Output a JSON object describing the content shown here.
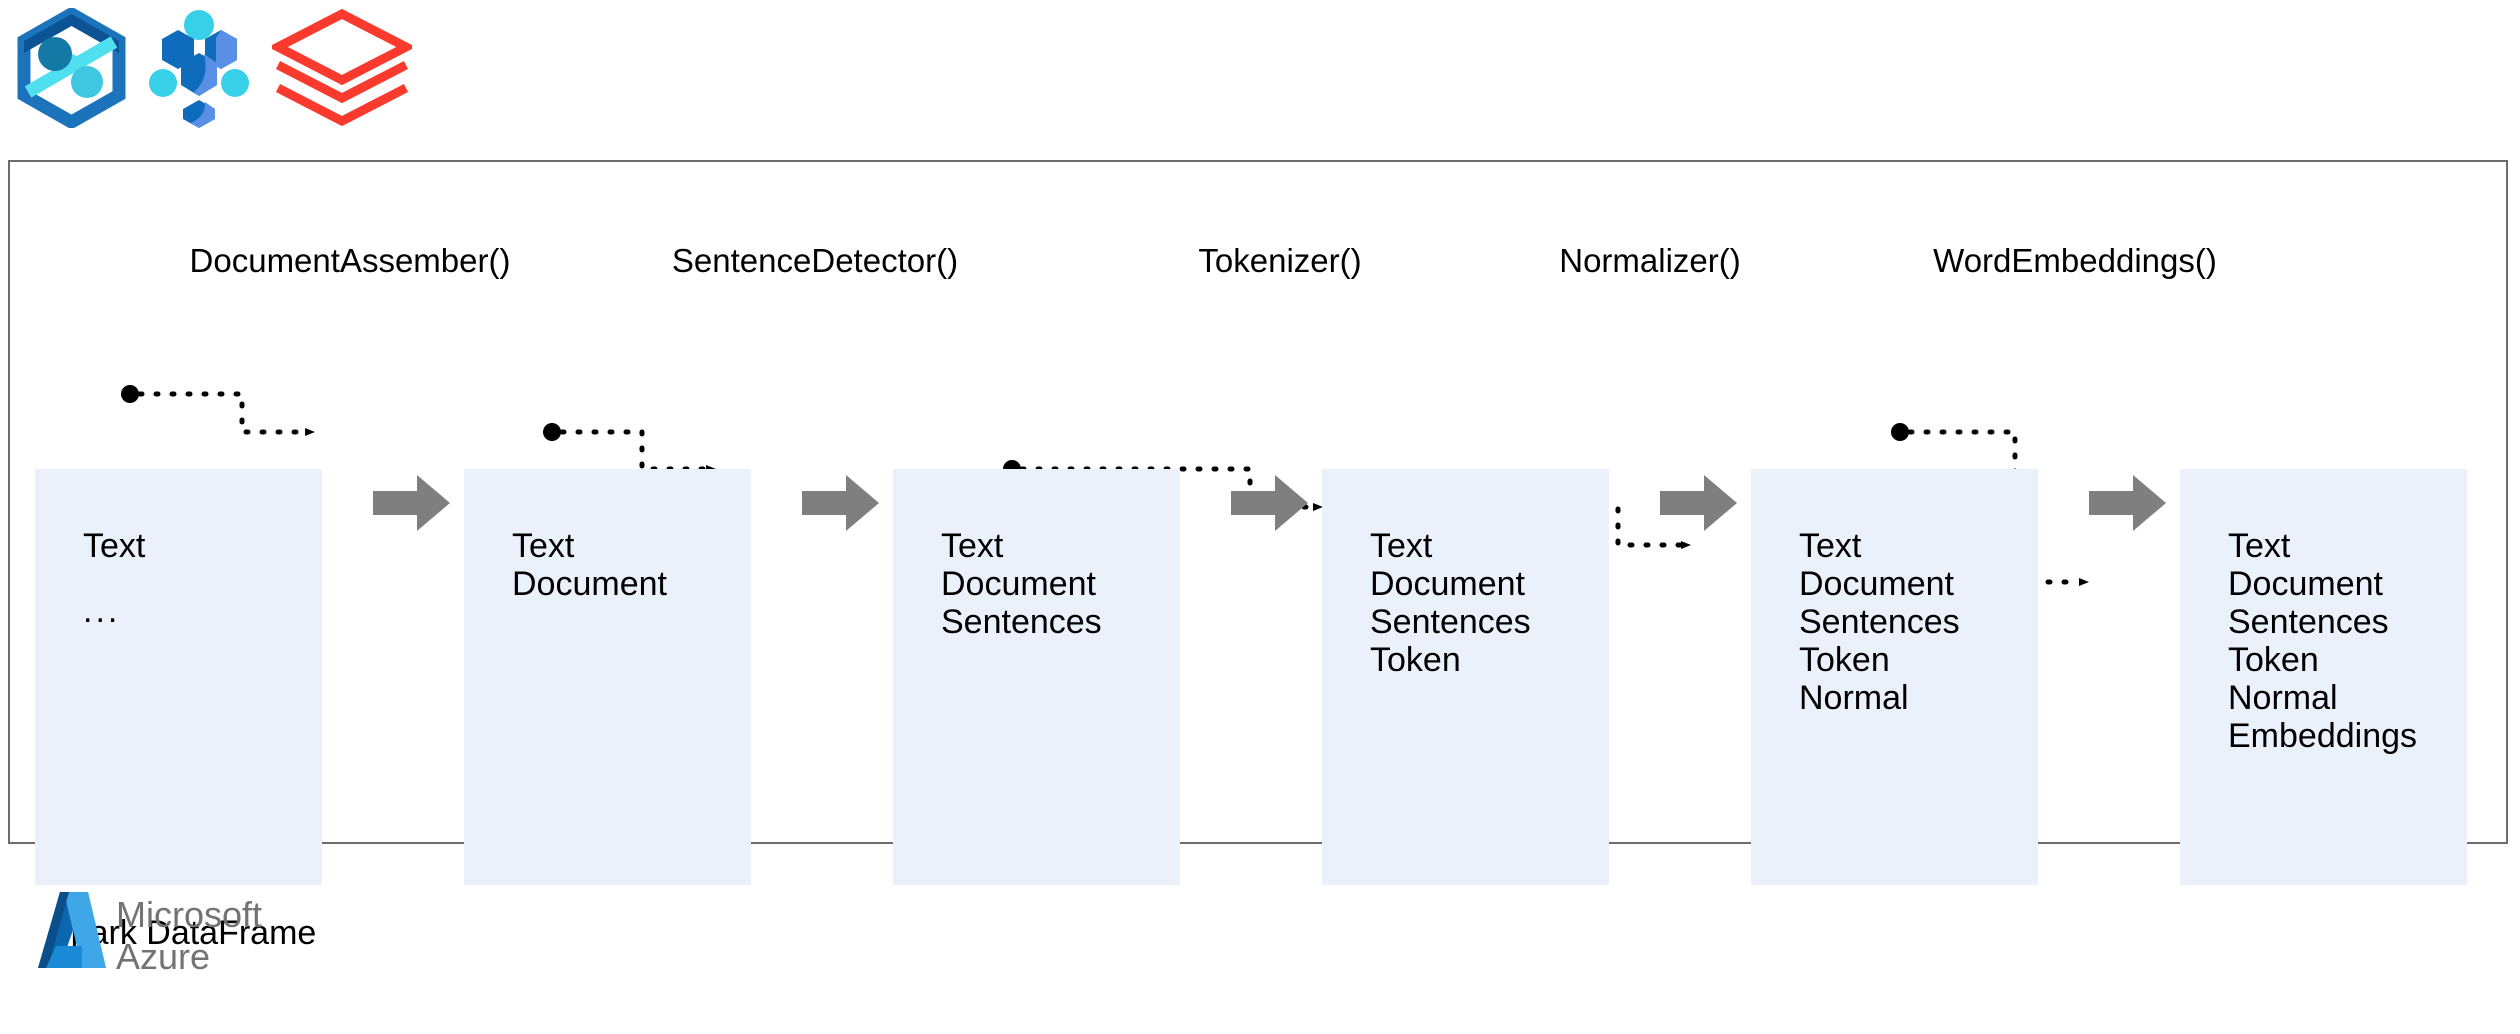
{
  "logos": [
    {
      "name": "azure-synapse-analytics-logo",
      "colors": {
        "outer": "#1b74bb",
        "outer_dark": "#0b5394",
        "accent": "#50dfee",
        "node_dark": "#1579a6"
      }
    },
    {
      "name": "azure-machine-learning-logo",
      "colors": {
        "primary": "#0f6cbd",
        "light": "#4fd1e8",
        "mid": "#5a8fe6"
      }
    },
    {
      "name": "spark-nlp-layers-logo",
      "colors": {
        "stroke": "#fb3a2e"
      }
    }
  ],
  "frame": {
    "caption": "Spark DataFrame",
    "border_color": "#6d6d6d"
  },
  "stages": [
    {
      "label": "DocumentAssember()"
    },
    {
      "label": "SentenceDetector()"
    },
    {
      "label": "Tokenizer()"
    },
    {
      "label": "Normalizer()"
    },
    {
      "label": "WordEmbeddings()"
    }
  ],
  "columns": [
    {
      "name": "input-dataframe",
      "rows": [
        {
          "text": "Text",
          "source_dot": true,
          "arrow_in": false
        },
        {
          "text": "...",
          "source_dot": false,
          "arrow_in": false
        }
      ]
    },
    {
      "name": "document-assembler-output",
      "rows": [
        {
          "text": "Text",
          "source_dot": false,
          "arrow_in": false
        },
        {
          "text": "Document",
          "source_dot": true,
          "arrow_in": true
        }
      ]
    },
    {
      "name": "sentence-detector-output",
      "rows": [
        {
          "text": "Text",
          "source_dot": false,
          "arrow_in": false
        },
        {
          "text": "Document",
          "source_dot": false,
          "arrow_in": false
        },
        {
          "text": "Sentences",
          "source_dot": true,
          "arrow_in": true
        }
      ]
    },
    {
      "name": "tokenizer-output",
      "rows": [
        {
          "text": "Text",
          "source_dot": false,
          "arrow_in": false
        },
        {
          "text": "Document",
          "source_dot": false,
          "arrow_in": false
        },
        {
          "text": "Sentences",
          "source_dot": false,
          "arrow_in": false
        },
        {
          "text": "Token",
          "source_dot": true,
          "arrow_in": true
        }
      ]
    },
    {
      "name": "normalizer-output",
      "rows": [
        {
          "text": "Text",
          "source_dot": false,
          "arrow_in": false
        },
        {
          "text": "Document",
          "source_dot": true,
          "arrow_in": false
        },
        {
          "text": "Sentences",
          "source_dot": false,
          "arrow_in": false
        },
        {
          "text": "Token",
          "source_dot": false,
          "arrow_in": false
        },
        {
          "text": "Normal",
          "source_dot": true,
          "arrow_in": true
        }
      ]
    },
    {
      "name": "word-embeddings-output",
      "rows": [
        {
          "text": "Text",
          "source_dot": false,
          "arrow_in": false
        },
        {
          "text": "Document",
          "source_dot": false,
          "arrow_in": false
        },
        {
          "text": "Sentences",
          "source_dot": false,
          "arrow_in": false
        },
        {
          "text": "Token",
          "source_dot": false,
          "arrow_in": false
        },
        {
          "text": "Normal",
          "source_dot": false,
          "arrow_in": false
        },
        {
          "text": "Embeddings",
          "source_dot": false,
          "arrow_in": true
        }
      ]
    }
  ],
  "footer": {
    "brand_line1": "Microsoft",
    "brand_line2": "Azure"
  },
  "colors": {
    "column_fill": "#eaf1fa",
    "chevron": "#7f7f7f",
    "connector": "#000000",
    "frame_border": "#6d6d6d",
    "wordmark": "#737373"
  }
}
